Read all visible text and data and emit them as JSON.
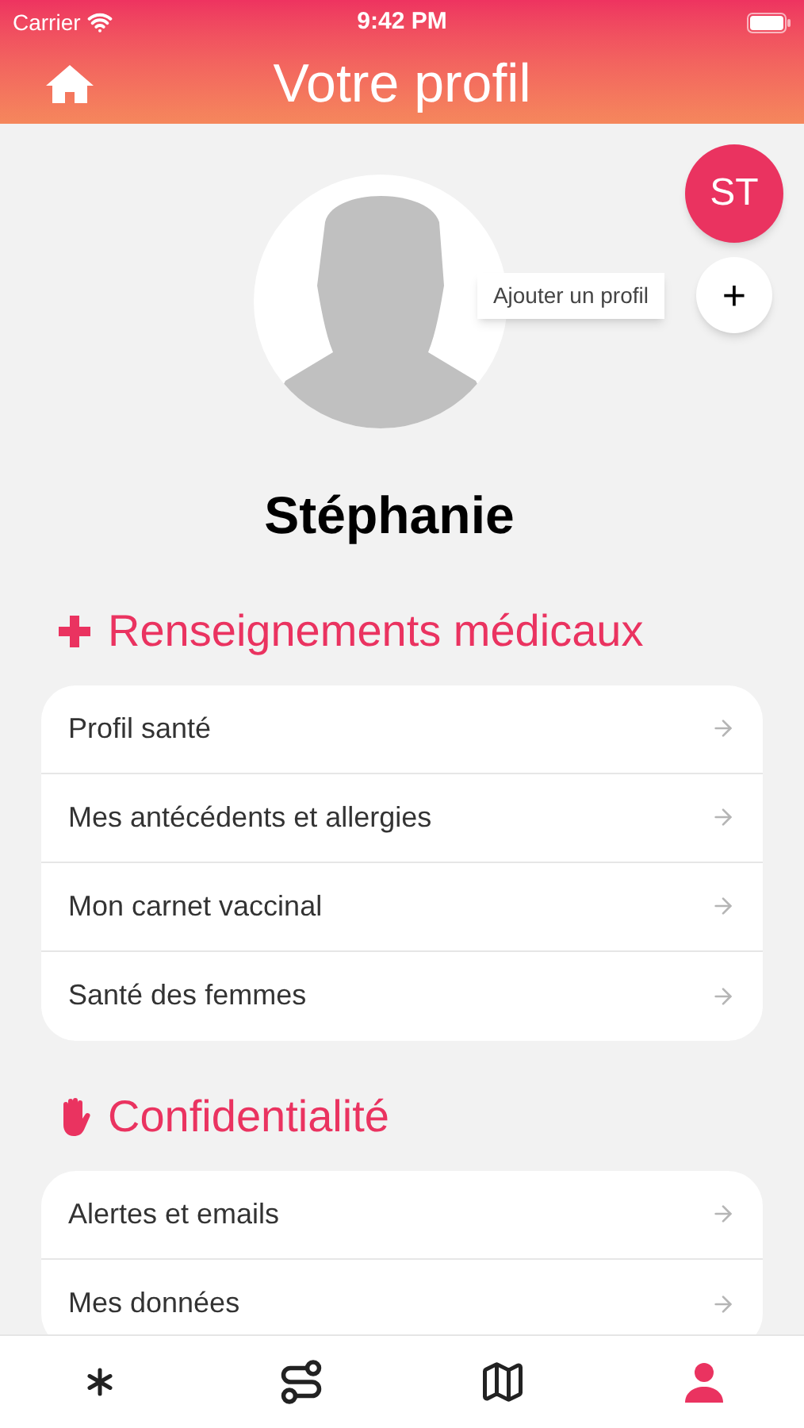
{
  "status_bar": {
    "carrier": "Carrier",
    "time": "9:42 PM"
  },
  "header": {
    "title": "Votre profil"
  },
  "profile": {
    "initials": "ST",
    "add_tooltip": "Ajouter un profil",
    "add_button": "+",
    "name": "Stéphanie"
  },
  "sections": [
    {
      "kind": "medical",
      "title": "Renseignements médicaux",
      "items": [
        "Profil santé",
        "Mes antécédents et allergies",
        "Mon carnet vaccinal",
        "Santé des femmes"
      ]
    },
    {
      "kind": "privacy",
      "title": "Confidentialité",
      "items": [
        "Alertes et emails",
        "Mes données"
      ]
    }
  ],
  "tab_bar": [
    {
      "kind": "asterisk",
      "selected": false
    },
    {
      "kind": "route",
      "selected": false
    },
    {
      "kind": "map",
      "selected": false
    },
    {
      "kind": "user",
      "selected": true
    }
  ]
}
